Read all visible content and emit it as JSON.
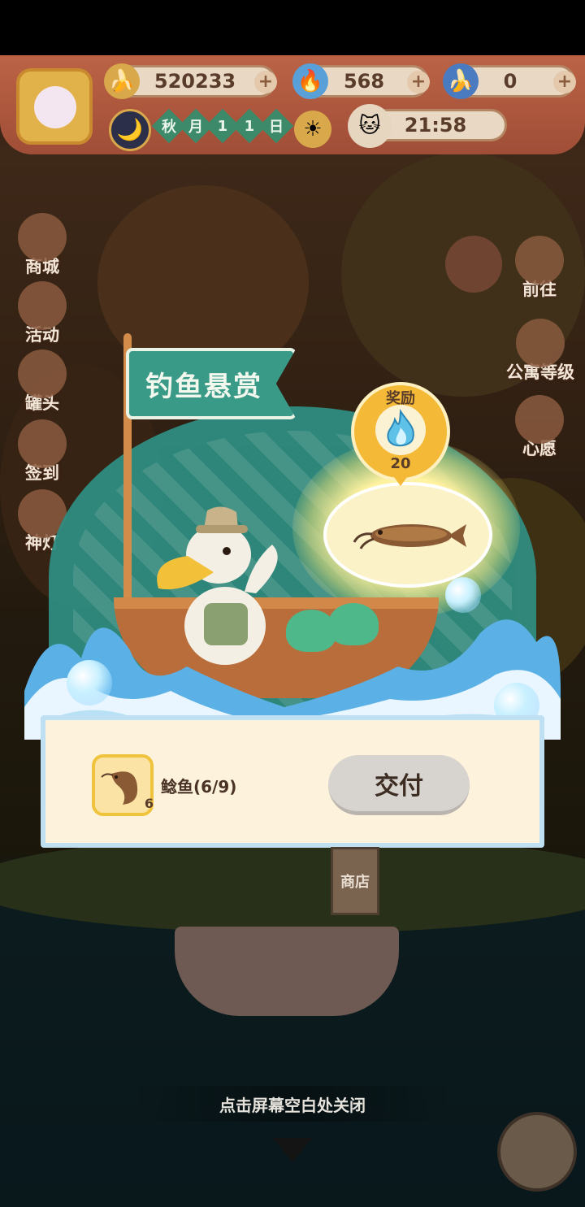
{
  "hud": {
    "currency_banana": "520233",
    "currency_flame": "568",
    "currency_blue_banana": "0",
    "season_chips": [
      "秋",
      "月",
      "1",
      "1",
      "日"
    ],
    "time": "21:58",
    "plus": "+"
  },
  "side_menu_left": [
    {
      "label": "商城",
      "icon": "shop-icon"
    },
    {
      "label": "活动",
      "icon": "gift-icon"
    },
    {
      "label": "罐头",
      "icon": "can-icon"
    },
    {
      "label": "签到",
      "icon": "calendar-icon"
    },
    {
      "label": "神灯",
      "icon": "lamp-icon"
    }
  ],
  "side_menu_right": [
    {
      "label": "前往",
      "icon": "map-pin-icon"
    },
    {
      "label": "公寓等级",
      "icon": "cat-badge-icon"
    },
    {
      "label": "心愿",
      "icon": "heart-book-icon"
    }
  ],
  "bounty": {
    "title": "钓鱼悬赏",
    "reward_label": "奖励",
    "reward_amount": "20",
    "reward_icon": "blue-flame-icon",
    "target_fish_icon": "catfish-icon",
    "fish_name": "鲶鱼(6/9)",
    "fish_count": "6",
    "deliver_button": "交付"
  },
  "shop_sign": "商店",
  "close_hint": "点击屏幕空白处关闭",
  "colors": {
    "flag": "#3a9a88",
    "reward_badge": "#f4b936",
    "card_bg": "#fdf2dc",
    "deliver_button": "#d7d3cf"
  }
}
